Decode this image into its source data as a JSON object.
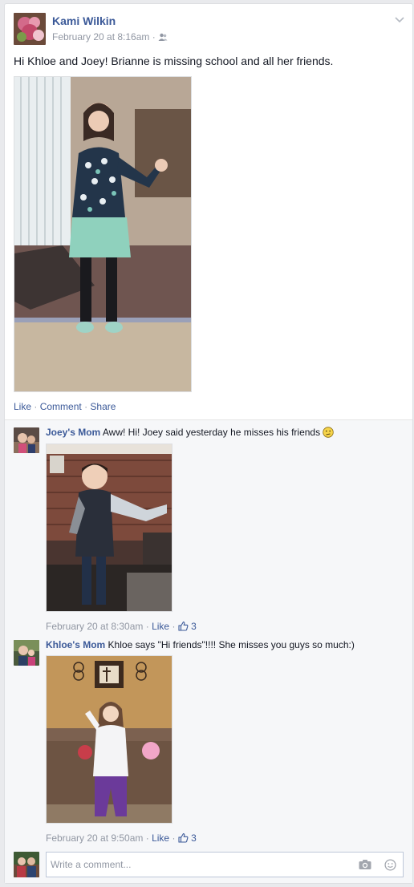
{
  "post": {
    "author": "Kami Wilkin",
    "timestamp": "February 20 at 8:16am",
    "separator": "·",
    "text": "Hi Khloe and Joey! Brianne is missing school and all her friends.",
    "actions": {
      "like": "Like",
      "comment": "Comment",
      "share": "Share",
      "dot": "·"
    }
  },
  "comments": [
    {
      "author": "Joey's Mom",
      "text": "Aww! Hi! Joey said yesterday he misses his friends",
      "timestamp": "February 20 at 8:30am",
      "like": "Like",
      "likes": "3",
      "dot": "·"
    },
    {
      "author": "Khloe's Mom",
      "text": "Khloe says \"Hi friends\"!!!! She misses you guys so much:)",
      "timestamp": "February 20 at 9:50am",
      "like": "Like",
      "likes": "3",
      "dot": "·"
    }
  ],
  "composer": {
    "placeholder": "Write a comment..."
  },
  "colors": {
    "link": "#3b5998",
    "meta": "#9197a3",
    "background": "#e9eaed",
    "comments_bg": "#f6f7f9"
  }
}
